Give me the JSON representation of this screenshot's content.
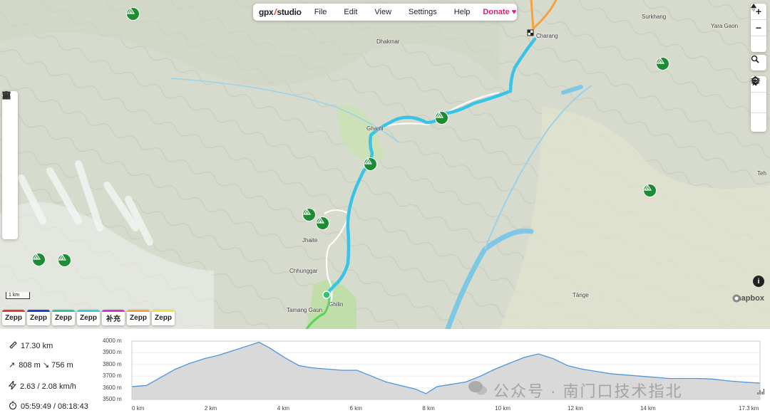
{
  "topbar": {
    "logo_left": "gpx",
    "logo_right": "studio",
    "menu": [
      "File",
      "Edit",
      "View",
      "Settings",
      "Help"
    ],
    "donate": "Donate"
  },
  "map": {
    "places": {
      "dhakmar": "Dhakmar",
      "ghami": "Ghami",
      "jhaite": "Jhaite",
      "chhunggar": "Chhunggar",
      "ghilin": "Ghilin",
      "tamang_gaun": "Tamang Gaun",
      "surkhang": "Surkhang",
      "yara_gaon": "Yara Gaon",
      "tange": "Tānge",
      "teh": "Teh",
      "charang": "Charang"
    },
    "scale": "1 km",
    "attribution": "mapbox",
    "route_color": "#39c3e6",
    "other_track_color": "#f5a23a"
  },
  "tracks": [
    {
      "label": "Zepp",
      "color": "#e53935"
    },
    {
      "label": "Zepp",
      "color": "#1a3fd6"
    },
    {
      "label": "Zepp",
      "color": "#2fc4a0"
    },
    {
      "label": "Zepp",
      "color": "#3ec6ea"
    },
    {
      "label": "补充",
      "color": "#d038c8"
    },
    {
      "label": "Zepp",
      "color": "#f5a23a"
    },
    {
      "label": "Zepp",
      "color": "#f2e23c"
    }
  ],
  "stats": {
    "distance": "17.30 km",
    "elevation": "808 m ↘ 756 m",
    "elevation_up_icon": "↗",
    "speed": "2.63 / 2.08 km/h",
    "time": "05:59:49 / 08:18:43"
  },
  "chart_data": {
    "type": "area",
    "x_unit": "km",
    "y_unit": "m",
    "xlim": [
      0,
      17.3
    ],
    "ylim": [
      3500,
      4000
    ],
    "y_ticks": [
      "4000 m",
      "3900 m",
      "3800 m",
      "3700 m",
      "3600 m",
      "3500 m"
    ],
    "x_ticks": [
      "0 km",
      "2 km",
      "4 km",
      "6 km",
      "8 km",
      "10 km",
      "12 km",
      "14 km",
      "17.3 km"
    ],
    "x": [
      0,
      0.4,
      0.8,
      1.2,
      1.6,
      2.0,
      2.4,
      2.8,
      3.2,
      3.5,
      3.8,
      4.2,
      4.6,
      5.0,
      5.4,
      5.8,
      6.2,
      6.6,
      7.0,
      7.4,
      7.8,
      8.1,
      8.4,
      8.8,
      9.2,
      9.6,
      10.0,
      10.4,
      10.8,
      11.2,
      11.6,
      12.0,
      12.4,
      12.8,
      13.2,
      13.6,
      14.0,
      14.4,
      14.8,
      15.2,
      15.6,
      16.0,
      16.4,
      16.8,
      17.3
    ],
    "y": [
      3610,
      3620,
      3690,
      3760,
      3810,
      3850,
      3880,
      3920,
      3960,
      3990,
      3940,
      3860,
      3790,
      3770,
      3760,
      3750,
      3750,
      3700,
      3650,
      3620,
      3590,
      3550,
      3610,
      3630,
      3650,
      3700,
      3760,
      3810,
      3860,
      3890,
      3850,
      3790,
      3760,
      3740,
      3720,
      3710,
      3700,
      3690,
      3680,
      3680,
      3680,
      3675,
      3660,
      3650,
      3640
    ],
    "line_color": "#4e95d9",
    "fill_color": "#d9d9d9"
  },
  "watermark": "公众号 · 南门口技术指北"
}
